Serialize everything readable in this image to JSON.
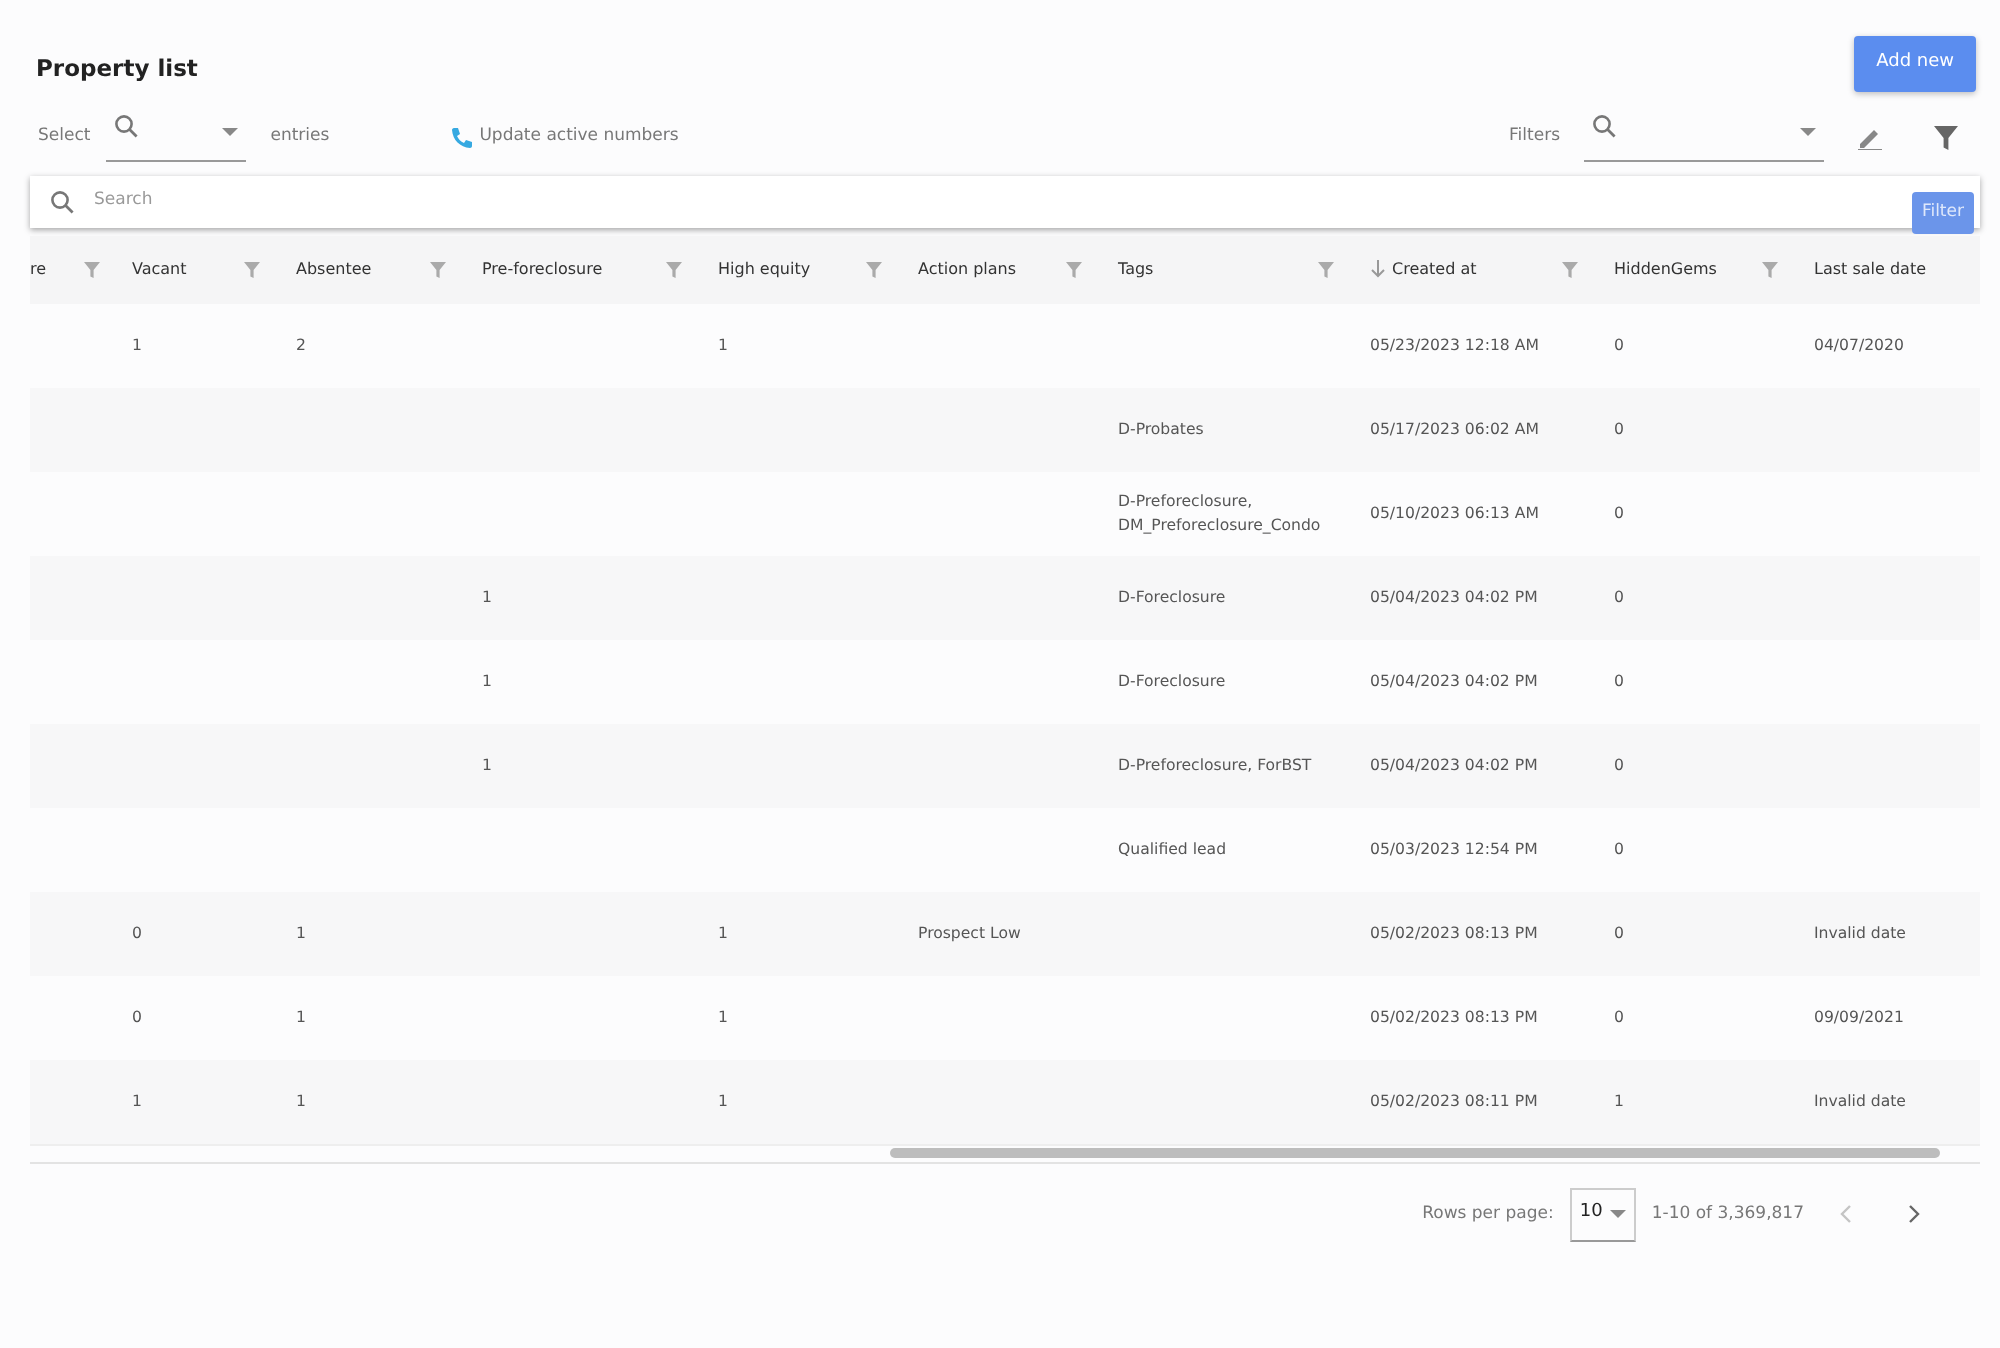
{
  "title": "Property list",
  "add_button": "Add new",
  "select": {
    "label": "Select",
    "suffix": "entries"
  },
  "update_link": "Update active numbers",
  "filters": {
    "label": "Filters"
  },
  "filter_tooltip": "Filter",
  "search": {
    "placeholder": "Search"
  },
  "table": {
    "columns": [
      {
        "label": "re",
        "sorted": false
      },
      {
        "label": "Vacant",
        "sorted": false
      },
      {
        "label": "Absentee",
        "sorted": false
      },
      {
        "label": "Pre-foreclosure",
        "sorted": false
      },
      {
        "label": "High equity",
        "sorted": false
      },
      {
        "label": "Action plans",
        "sorted": false
      },
      {
        "label": "Tags",
        "sorted": false
      },
      {
        "label": "Created at",
        "sorted": true
      },
      {
        "label": "HiddenGems",
        "sorted": false
      },
      {
        "label": "Last sale date",
        "sorted": false
      }
    ],
    "rows": [
      [
        "",
        "1",
        "2",
        "",
        "1",
        "",
        "",
        "05/23/2023 12:18 AM",
        "0",
        "04/07/2020"
      ],
      [
        "",
        "",
        "",
        "",
        "",
        "",
        "D-Probates",
        "05/17/2023 06:02 AM",
        "0",
        ""
      ],
      [
        "",
        "",
        "",
        "",
        "",
        "",
        "D-Preforeclosure, DM_Preforeclosure_Condo",
        "05/10/2023 06:13 AM",
        "0",
        ""
      ],
      [
        "",
        "",
        "",
        "1",
        "",
        "",
        "D-Foreclosure",
        "05/04/2023 04:02 PM",
        "0",
        ""
      ],
      [
        "",
        "",
        "",
        "1",
        "",
        "",
        "D-Foreclosure",
        "05/04/2023 04:02 PM",
        "0",
        ""
      ],
      [
        "",
        "",
        "",
        "1",
        "",
        "",
        "D-Preforeclosure, ForBST",
        "05/04/2023 04:02 PM",
        "0",
        ""
      ],
      [
        "",
        "",
        "",
        "",
        "",
        "",
        "Qualified lead",
        "05/03/2023 12:54 PM",
        "0",
        ""
      ],
      [
        "",
        "0",
        "1",
        "",
        "1",
        "Prospect Low",
        "",
        "05/02/2023 08:13 PM",
        "0",
        "Invalid date"
      ],
      [
        "",
        "0",
        "1",
        "",
        "1",
        "",
        "",
        "05/02/2023 08:13 PM",
        "0",
        "09/09/2021"
      ],
      [
        "",
        "1",
        "1",
        "",
        "1",
        "",
        "",
        "05/02/2023 08:11 PM",
        "1",
        "Invalid date"
      ]
    ]
  },
  "pagination": {
    "rows_label": "Rows per page:",
    "rows_value": "10",
    "range": "1-10 of 3,369,817",
    "prev_disabled": true,
    "next_disabled": false
  }
}
